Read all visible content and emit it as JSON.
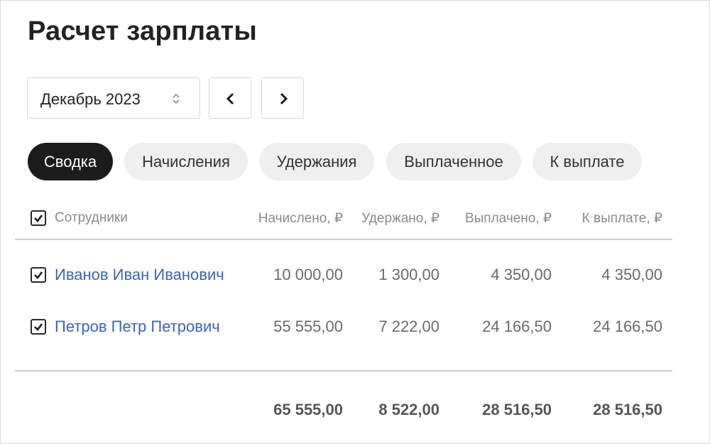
{
  "page": {
    "title": "Расчет зарплаты"
  },
  "period": {
    "selected": "Декабрь 2023",
    "prev_icon": "chevron-left-icon",
    "next_icon": "chevron-right-icon",
    "select_icon": "sort-arrows-icon"
  },
  "tabs": [
    {
      "label": "Сводка",
      "active": true
    },
    {
      "label": "Начисления",
      "active": false
    },
    {
      "label": "Удержания",
      "active": false
    },
    {
      "label": "Выплаченное",
      "active": false
    },
    {
      "label": "К выплате",
      "active": false
    }
  ],
  "table": {
    "headers": {
      "employees": "Сотрудники",
      "accrued": "Начислено, ₽",
      "withheld": "Удержано, ₽",
      "paid": "Выплачено, ₽",
      "to_pay": "К выплате, ₽"
    },
    "header_checked": true,
    "rows": [
      {
        "name": "Иванов Иван Иванович",
        "checked": true,
        "accrued": "10 000,00",
        "withheld": "1 300,00",
        "paid": "4 350,00",
        "to_pay": "4 350,00"
      },
      {
        "name": "Петров Петр Петрович",
        "checked": true,
        "accrued": "55 555,00",
        "withheld": "7 222,00",
        "paid": "24 166,50",
        "to_pay": "24 166,50"
      }
    ],
    "totals": {
      "accrued": "65 555,00",
      "withheld": "8 522,00",
      "paid": "28 516,50",
      "to_pay": "28 516,50"
    }
  },
  "colors": {
    "accent_link": "#3b63b8",
    "active_tab_bg": "#1c1c1c",
    "tab_bg": "#efefef"
  }
}
